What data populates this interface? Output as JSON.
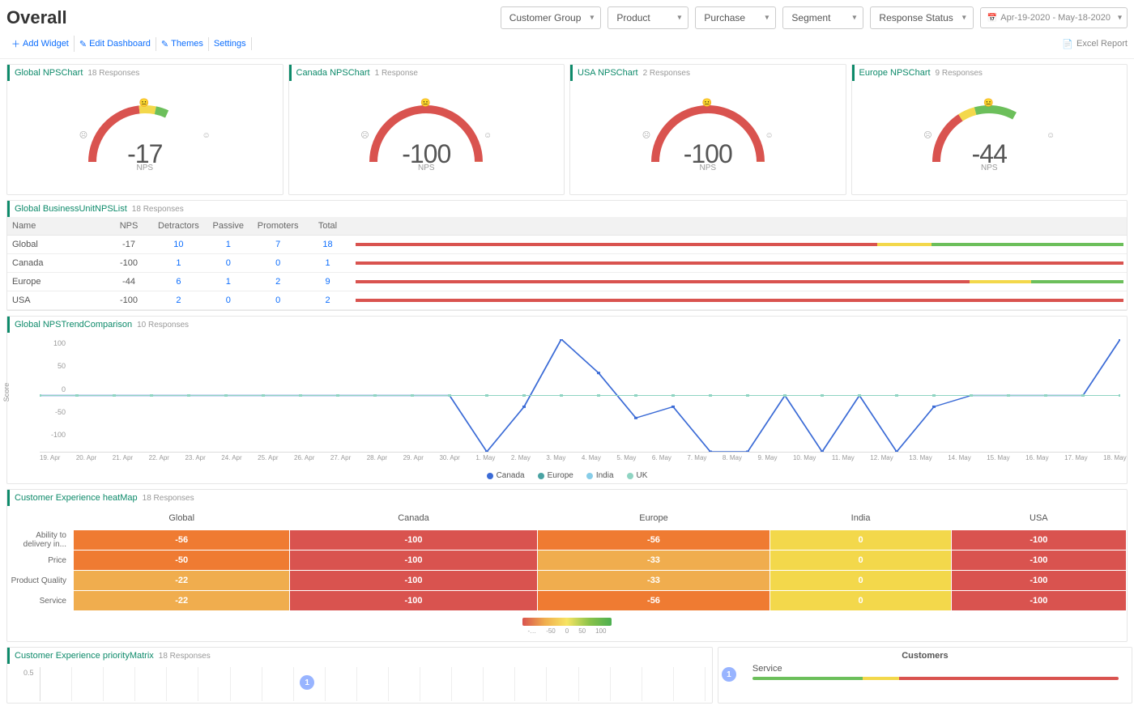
{
  "header": {
    "title": "Overall"
  },
  "filters": {
    "group": "Customer Group",
    "product": "Product",
    "purchase": "Purchase",
    "segment": "Segment",
    "response_status": "Response Status",
    "daterange": "Apr-19-2020 - May-18-2020"
  },
  "toolbar": {
    "add_widget": "Add Widget",
    "edit_dashboard": "Edit Dashboard",
    "themes": "Themes",
    "settings": "Settings",
    "excel_report": "Excel Report"
  },
  "nps_cards": [
    {
      "title": "Global NPSChart",
      "sub": "18 Responses",
      "value": "-17",
      "label": "NPS"
    },
    {
      "title": "Canada NPSChart",
      "sub": "1 Response",
      "value": "-100",
      "label": "NPS"
    },
    {
      "title": "USA NPSChart",
      "sub": "2 Responses",
      "value": "-100",
      "label": "NPS"
    },
    {
      "title": "Europe NPSChart",
      "sub": "9 Responses",
      "value": "-44",
      "label": "NPS"
    }
  ],
  "nps_list": {
    "title": "Global BusinessUnitNPSList",
    "sub": "18 Responses",
    "columns": [
      "Name",
      "NPS",
      "Detractors",
      "Passive",
      "Promoters",
      "Total"
    ],
    "rows": [
      {
        "name": "Global",
        "nps": "-17",
        "detractors": "10",
        "passive": "1",
        "promoters": "7",
        "total": "18",
        "seg": [
          68,
          7,
          25
        ]
      },
      {
        "name": "Canada",
        "nps": "-100",
        "detractors": "1",
        "passive": "0",
        "promoters": "0",
        "total": "1",
        "seg": [
          100,
          0,
          0
        ]
      },
      {
        "name": "Europe",
        "nps": "-44",
        "detractors": "6",
        "passive": "1",
        "promoters": "2",
        "total": "9",
        "seg": [
          80,
          8,
          12
        ]
      },
      {
        "name": "USA",
        "nps": "-100",
        "detractors": "2",
        "passive": "0",
        "promoters": "0",
        "total": "2",
        "seg": [
          100,
          0,
          0
        ]
      }
    ]
  },
  "trend": {
    "title": "Global NPSTrendComparison",
    "sub": "10 Responses",
    "yticks": [
      "100",
      "50",
      "0",
      "-50",
      "-100"
    ],
    "ylabel": "Score",
    "legend": [
      {
        "name": "Canada",
        "color": "#3b6bd6"
      },
      {
        "name": "Europe",
        "color": "#4aa3a3"
      },
      {
        "name": "India",
        "color": "#87cde8"
      },
      {
        "name": "UK",
        "color": "#8fd4c2"
      }
    ],
    "xticks": [
      "19. Apr",
      "20. Apr",
      "21. Apr",
      "22. Apr",
      "23. Apr",
      "24. Apr",
      "25. Apr",
      "26. Apr",
      "27. Apr",
      "28. Apr",
      "29. Apr",
      "30. Apr",
      "1. May",
      "2. May",
      "3. May",
      "4. May",
      "5. May",
      "6. May",
      "7. May",
      "8. May",
      "9. May",
      "10. May",
      "11. May",
      "12. May",
      "13. May",
      "14. May",
      "15. May",
      "16. May",
      "17. May",
      "18. May"
    ]
  },
  "heatmap": {
    "title": "Customer Experience heatMap",
    "sub": "18 Responses",
    "cols": [
      "Global",
      "Canada",
      "Europe",
      "India",
      "USA"
    ],
    "rows": [
      {
        "name": "Ability to delivery in...",
        "cells": [
          {
            "v": "-56",
            "c": "#ef7b32"
          },
          {
            "v": "-100",
            "c": "#d9534f"
          },
          {
            "v": "-56",
            "c": "#ef7b32"
          },
          {
            "v": "0",
            "c": "#f3d84b"
          },
          {
            "v": "-100",
            "c": "#d9534f"
          }
        ]
      },
      {
        "name": "Price",
        "cells": [
          {
            "v": "-50",
            "c": "#ef7b32"
          },
          {
            "v": "-100",
            "c": "#d9534f"
          },
          {
            "v": "-33",
            "c": "#f0ad4e"
          },
          {
            "v": "0",
            "c": "#f3d84b"
          },
          {
            "v": "-100",
            "c": "#d9534f"
          }
        ]
      },
      {
        "name": "Product Quality",
        "cells": [
          {
            "v": "-22",
            "c": "#f0ad4e"
          },
          {
            "v": "-100",
            "c": "#d9534f"
          },
          {
            "v": "-33",
            "c": "#f0ad4e"
          },
          {
            "v": "0",
            "c": "#f3d84b"
          },
          {
            "v": "-100",
            "c": "#d9534f"
          }
        ]
      },
      {
        "name": "Service",
        "cells": [
          {
            "v": "-22",
            "c": "#f0ad4e"
          },
          {
            "v": "-100",
            "c": "#d9534f"
          },
          {
            "v": "-56",
            "c": "#ef7b32"
          },
          {
            "v": "0",
            "c": "#f3d84b"
          },
          {
            "v": "-100",
            "c": "#d9534f"
          }
        ]
      }
    ],
    "scale": [
      "-…",
      "-50",
      "0",
      "50",
      "100"
    ]
  },
  "priority": {
    "title": "Customer Experience priorityMatrix",
    "sub": "18 Responses",
    "ytick": "0.5",
    "bubble": "1"
  },
  "customers_panel": {
    "heading": "Customers",
    "bubble": "1",
    "row_label": "Service",
    "seg": [
      30,
      10,
      60
    ]
  },
  "chart_data": [
    {
      "type": "bar",
      "title": "Global BusinessUnitNPSList — composition",
      "categories": [
        "Global",
        "Canada",
        "Europe",
        "USA"
      ],
      "series": [
        {
          "name": "Detractors",
          "values": [
            10,
            1,
            6,
            2
          ]
        },
        {
          "name": "Passive",
          "values": [
            1,
            0,
            1,
            0
          ]
        },
        {
          "name": "Promoters",
          "values": [
            7,
            0,
            2,
            0
          ]
        }
      ]
    },
    {
      "type": "line",
      "title": "Global NPSTrendComparison",
      "ylabel": "Score",
      "ylim": [
        -100,
        100
      ],
      "x": [
        "19. Apr",
        "20. Apr",
        "21. Apr",
        "22. Apr",
        "23. Apr",
        "24. Apr",
        "25. Apr",
        "26. Apr",
        "27. Apr",
        "28. Apr",
        "29. Apr",
        "30. Apr",
        "1. May",
        "2. May",
        "3. May",
        "4. May",
        "5. May",
        "6. May",
        "7. May",
        "8. May",
        "9. May",
        "10. May",
        "11. May",
        "12. May",
        "13. May",
        "14. May",
        "15. May",
        "16. May",
        "17. May",
        "18. May"
      ],
      "series": [
        {
          "name": "Canada",
          "values": [
            0,
            0,
            0,
            0,
            0,
            0,
            0,
            0,
            0,
            0,
            0,
            0,
            -100,
            -20,
            100,
            40,
            -40,
            -20,
            -100,
            -100,
            0,
            -100,
            0,
            -100,
            -20,
            0,
            0,
            0,
            0,
            100
          ]
        },
        {
          "name": "Europe",
          "values": [
            0,
            0,
            0,
            0,
            0,
            0,
            0,
            0,
            0,
            0,
            0,
            0,
            0,
            0,
            0,
            0,
            0,
            0,
            0,
            0,
            0,
            0,
            0,
            0,
            0,
            0,
            0,
            0,
            0,
            0
          ]
        },
        {
          "name": "India",
          "values": [
            0,
            0,
            0,
            0,
            0,
            0,
            0,
            0,
            0,
            0,
            0,
            0,
            0,
            0,
            0,
            0,
            0,
            0,
            0,
            0,
            0,
            0,
            0,
            0,
            0,
            0,
            0,
            0,
            0,
            0
          ]
        },
        {
          "name": "UK",
          "values": [
            0,
            0,
            0,
            0,
            0,
            0,
            0,
            0,
            0,
            0,
            0,
            0,
            0,
            0,
            0,
            0,
            0,
            0,
            0,
            0,
            0,
            0,
            0,
            0,
            0,
            0,
            0,
            0,
            0,
            0
          ]
        }
      ]
    },
    {
      "type": "heatmap",
      "title": "Customer Experience heatMap",
      "x": [
        "Global",
        "Canada",
        "Europe",
        "India",
        "USA"
      ],
      "y": [
        "Ability to delivery in...",
        "Price",
        "Product Quality",
        "Service"
      ],
      "values": [
        [
          -56,
          -100,
          -56,
          0,
          -100
        ],
        [
          -50,
          -100,
          -33,
          0,
          -100
        ],
        [
          -22,
          -100,
          -33,
          0,
          -100
        ],
        [
          -22,
          -100,
          -56,
          0,
          -100
        ]
      ],
      "zlim": [
        -100,
        100
      ]
    }
  ]
}
